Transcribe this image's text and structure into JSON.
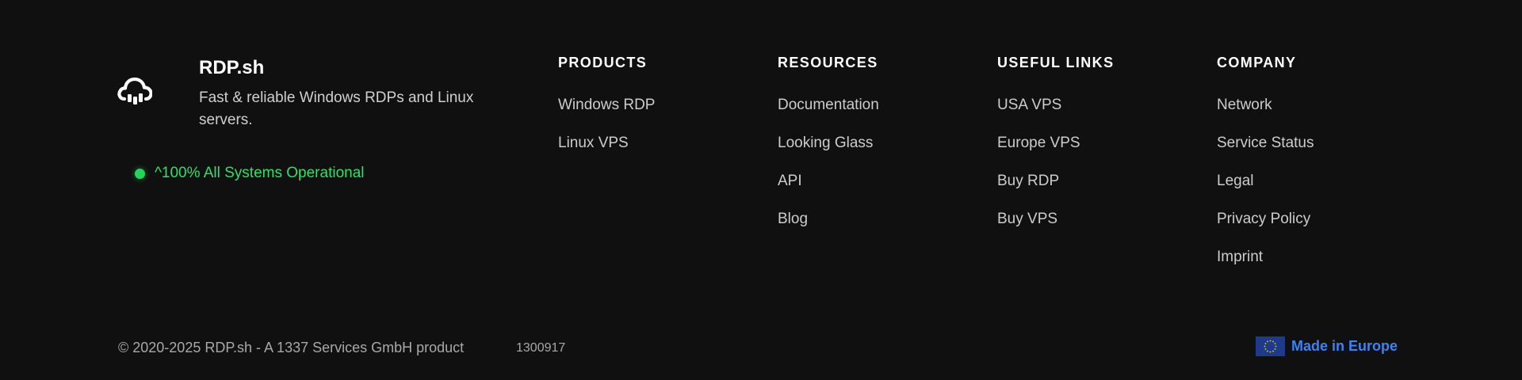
{
  "brand": {
    "name": "RDP.sh",
    "tagline": "Fast & reliable Windows RDPs and Linux servers.",
    "logo_icon": "cloud-server-icon"
  },
  "status": {
    "text": "^100% All Systems Operational",
    "color": "#22d65a"
  },
  "columns": [
    {
      "title": "PRODUCTS",
      "links": [
        "Windows RDP",
        "Linux VPS"
      ]
    },
    {
      "title": "RESOURCES",
      "links": [
        "Documentation",
        "Looking Glass",
        "API",
        "Blog"
      ]
    },
    {
      "title": "USEFUL LINKS",
      "links": [
        "USA VPS",
        "Europe VPS",
        "Buy RDP",
        "Buy VPS"
      ]
    },
    {
      "title": "COMPANY",
      "links": [
        "Network",
        "Service Status",
        "Legal",
        "Privacy Policy",
        "Imprint"
      ]
    }
  ],
  "bottom": {
    "copyright": "© 2020-2025 RDP.sh - A 1337 Services GmbH product",
    "build": "1300917",
    "made_in": "Made in Europe",
    "flag_icon": "eu-flag-icon",
    "accent_color": "#3b82f6"
  }
}
